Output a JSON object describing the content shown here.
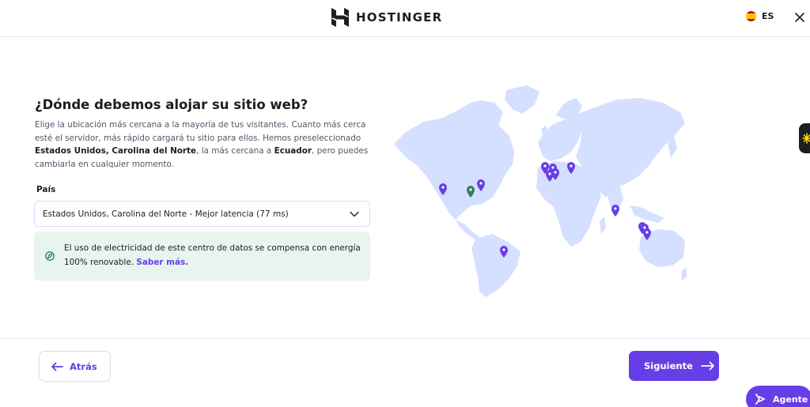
{
  "header": {
    "brand": "HOSTINGER",
    "language": "ES"
  },
  "main": {
    "title": "¿Dónde debemos alojar su sitio web?",
    "description": {
      "part1": "Elige la ubicación más cercana a la mayoría de tus visitantes. Cuanto más cerca esté el servidor, más rápido cargará tu sitio para ellos. Hemos preseleccionado ",
      "bold1": "Estados Unidos, Carolina del Norte",
      "part2": ", la más cercana a ",
      "bold2": "Ecuador",
      "part3": ", pero puedes cambiarla en cualquier momento."
    },
    "country_label": "País",
    "country_selected": "Estados Unidos, Carolina del Norte - Mejor latencia (77 ms)",
    "info_text": "El uso de electricidad de este centro de datos se compensa con energía 100% renovable. ",
    "info_link": "Saber más."
  },
  "footer": {
    "back_label": "Atrás",
    "next_label": "Siguiente",
    "agent_label": "Agente"
  },
  "colors": {
    "accent": "#673de6",
    "selected_pin": "#357a62",
    "map_land": "#d5dfff",
    "info_bg": "#e8f4ee"
  },
  "icons": {
    "back": "arrow-left-icon",
    "next": "arrow-right-icon",
    "close": "close-icon",
    "dropdown": "chevron-down-icon",
    "info": "leaf-icon",
    "agent": "sparkle-icon"
  }
}
